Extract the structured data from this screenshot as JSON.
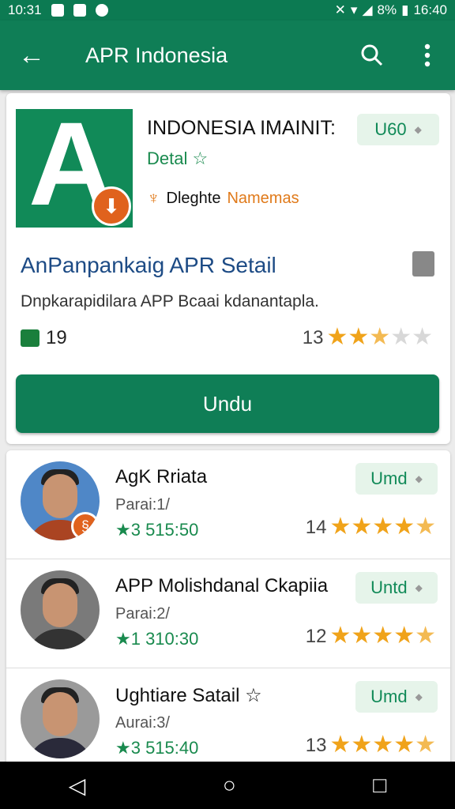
{
  "status_bar": {
    "time": "10:31",
    "battery": "8%",
    "clock": "16:40"
  },
  "appbar": {
    "back_icon": "arrow-left-icon",
    "title": "APR Indonesia",
    "search_icon": "search-icon",
    "more_icon": "more-vert-icon"
  },
  "app": {
    "logo_letter": "A",
    "title": "INDONESIA IMAINIT:",
    "subtitle": "Detal ☆",
    "developer_prefix": "Dleghte",
    "developer_suffix": "Namemas",
    "chip_label": "U60",
    "headline": "AnPanpankaig APR Setail",
    "description": "Dnpkarapidilara APP Bcaai kdanantapla.",
    "lock_count": "19",
    "rating_count": "13",
    "rating_value": 2.5,
    "download_label": "Undu"
  },
  "list": [
    {
      "name": "AgK Rriata",
      "meta": "Parai:1/",
      "time": "★3 515:50",
      "chip": "Umd",
      "rating_count": "14",
      "rating_value": 4.5
    },
    {
      "name": "APP Molishdanal Ckapiia",
      "meta": "Parai:2/",
      "time": "★1 310:30",
      "chip": "Untd",
      "rating_count": "12",
      "rating_value": 4.5
    },
    {
      "name": "Ughtiare Satail ☆",
      "meta": "Aurai:3/",
      "time": "★3 515:40",
      "chip": "Umd",
      "rating_count": "13",
      "rating_value": 4.5
    }
  ],
  "nav": {
    "back": "◁",
    "home": "○",
    "recents": "□"
  },
  "colors": {
    "primary": "#0f7e56",
    "accent": "#e0621d",
    "star": "#f0a31a"
  }
}
